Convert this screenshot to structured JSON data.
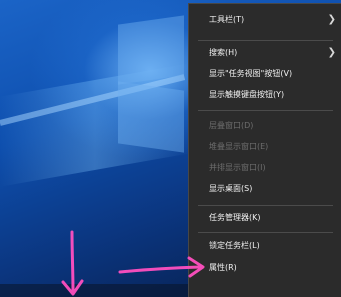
{
  "context_menu": {
    "items": [
      {
        "id": "toolbars",
        "label": "工具栏(T)",
        "has_submenu": true,
        "disabled": false
      },
      {
        "id": "search",
        "label": "搜索(H)",
        "has_submenu": true,
        "disabled": false
      },
      {
        "id": "show_task_view",
        "label": "显示\"任务视图\"按钮(V)",
        "has_submenu": false,
        "disabled": false
      },
      {
        "id": "show_touch_keyboard",
        "label": "显示触摸键盘按钮(Y)",
        "has_submenu": false,
        "disabled": false
      },
      {
        "id": "cascade",
        "label": "层叠窗口(D)",
        "has_submenu": false,
        "disabled": true
      },
      {
        "id": "stacked",
        "label": "堆叠显示窗口(E)",
        "has_submenu": false,
        "disabled": true
      },
      {
        "id": "side_by_side",
        "label": "并排显示窗口(I)",
        "has_submenu": false,
        "disabled": true
      },
      {
        "id": "show_desktop",
        "label": "显示桌面(S)",
        "has_submenu": false,
        "disabled": false
      },
      {
        "id": "task_manager",
        "label": "任务管理器(K)",
        "has_submenu": false,
        "disabled": false
      },
      {
        "id": "lock_taskbar",
        "label": "锁定任务栏(L)",
        "has_submenu": false,
        "disabled": false
      },
      {
        "id": "properties",
        "label": "属性(R)",
        "has_submenu": false,
        "disabled": false
      }
    ]
  },
  "icons": {
    "submenu_arrow": "chevron-right-icon",
    "annotation_down": "down-arrow-annotation",
    "annotation_right": "right-arrow-annotation"
  },
  "colors": {
    "menu_background": "#2b2b2b",
    "menu_text": "#f2f2f2",
    "menu_text_disabled": "#6d6d6d",
    "separator": "#4b4b4b",
    "annotation": "#ff4fc0",
    "desktop_blue": "#0e4fae"
  }
}
